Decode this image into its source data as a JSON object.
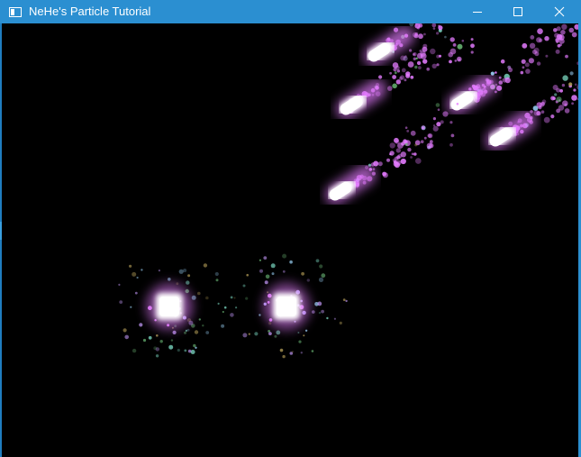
{
  "window": {
    "title": "NeHe's Particle Tutorial",
    "accent_color": "#2b8fd1",
    "icons": {
      "app": "console-window-icon",
      "minimize": "minimize-icon",
      "maximize": "maximize-icon",
      "close": "close-icon"
    }
  },
  "scene": {
    "background_color": "#000000",
    "trail_color": "#e47bff",
    "core_color": "#ffffff",
    "sparkle_colors": [
      "#9fd8ff",
      "#7fe0c8",
      "#c89cff",
      "#6fbf7a",
      "#b9a25a"
    ]
  }
}
